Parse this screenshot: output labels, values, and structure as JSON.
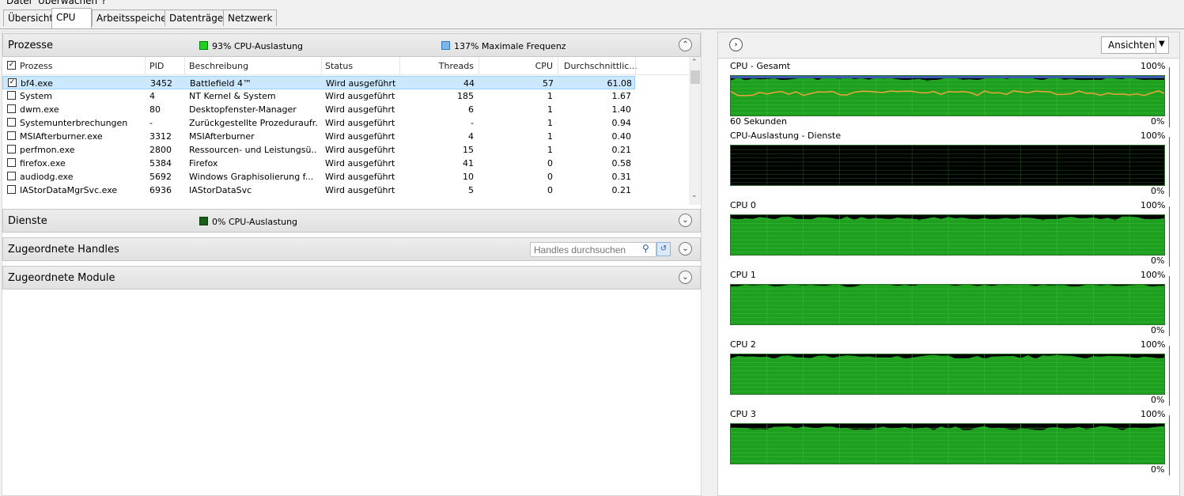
{
  "menu": {
    "items": [
      "Datei",
      "Überwachen",
      "?"
    ]
  },
  "tabs": [
    "Übersicht",
    "CPU",
    "Arbeitsspeicher",
    "Datenträger",
    "Netzwerk"
  ],
  "active_tab": "CPU",
  "processes": {
    "title": "Prozesse",
    "cpu_usage": "93% CPU-Auslastung",
    "max_freq": "137% Maximale Frequenz",
    "columns": [
      "Prozess",
      "PID",
      "Beschreibung",
      "Status",
      "Threads",
      "CPU",
      "Durchschnittlic..."
    ],
    "rows": [
      {
        "checked": true,
        "name": "bf4.exe",
        "pid": "3452",
        "desc": "Battlefield 4™",
        "status": "Wird ausgeführt",
        "threads": "44",
        "cpu": "57",
        "avg": "61.08"
      },
      {
        "checked": false,
        "name": "System",
        "pid": "4",
        "desc": "NT Kernel & System",
        "status": "Wird ausgeführt",
        "threads": "185",
        "cpu": "1",
        "avg": "1.67"
      },
      {
        "checked": false,
        "name": "dwm.exe",
        "pid": "80",
        "desc": "Desktopfenster-Manager",
        "status": "Wird ausgeführt",
        "threads": "6",
        "cpu": "1",
        "avg": "1.40"
      },
      {
        "checked": false,
        "name": "Systemunterbrechungen",
        "pid": "-",
        "desc": "Zurückgestellte Prozeduraufr...",
        "status": "Wird ausgeführt",
        "threads": "-",
        "cpu": "1",
        "avg": "0.94"
      },
      {
        "checked": false,
        "name": "MSIAfterburner.exe",
        "pid": "3312",
        "desc": "MSIAfterburner",
        "status": "Wird ausgeführt",
        "threads": "4",
        "cpu": "1",
        "avg": "0.40"
      },
      {
        "checked": false,
        "name": "perfmon.exe",
        "pid": "2800",
        "desc": "Ressourcen- und Leistungsü...",
        "status": "Wird ausgeführt",
        "threads": "15",
        "cpu": "1",
        "avg": "0.21"
      },
      {
        "checked": false,
        "name": "firefox.exe",
        "pid": "5384",
        "desc": "Firefox",
        "status": "Wird ausgeführt",
        "threads": "41",
        "cpu": "0",
        "avg": "0.58"
      },
      {
        "checked": false,
        "name": "audiodg.exe",
        "pid": "5692",
        "desc": "Windows Graphisolierung f...",
        "status": "Wird ausgeführt",
        "threads": "10",
        "cpu": "0",
        "avg": "0.31"
      },
      {
        "checked": false,
        "name": "IAStorDataMgrSvc.exe",
        "pid": "6936",
        "desc": "IAStorDataSvc",
        "status": "Wird ausgeführt",
        "threads": "5",
        "cpu": "0",
        "avg": "0.21"
      }
    ]
  },
  "services": {
    "title": "Dienste",
    "cpu_usage": "0% CPU-Auslastung"
  },
  "handles": {
    "title": "Zugeordnete Handles",
    "search_placeholder": "Handles durchsuchen"
  },
  "modules": {
    "title": "Zugeordnete Module"
  },
  "right": {
    "views_label": "Ansichten",
    "graphs": [
      {
        "label": "CPU - Gesamt",
        "max": "100%",
        "min": "0%",
        "sub_label": "60 Sekunden",
        "level": 0.93,
        "freq_line": true
      },
      {
        "label": "CPU-Auslastung - Dienste",
        "max": "100%",
        "min": "0%",
        "level": 0.0
      },
      {
        "label": "CPU 0",
        "max": "100%",
        "min": "0%",
        "level": 0.92
      },
      {
        "label": "CPU 1",
        "max": "100%",
        "min": "0%",
        "level": 0.99
      },
      {
        "label": "CPU 2",
        "max": "100%",
        "min": "0%",
        "level": 0.94
      },
      {
        "label": "CPU 3",
        "max": "100%",
        "min": "0%",
        "level": 0.9
      }
    ]
  },
  "colors": {
    "graph_green": "#1ea01e",
    "graph_dark": "#000000",
    "grid": "#39b339",
    "freq_line": "#e8a33a",
    "top_line": "#3b5db0",
    "selection": "#cce8ff"
  }
}
